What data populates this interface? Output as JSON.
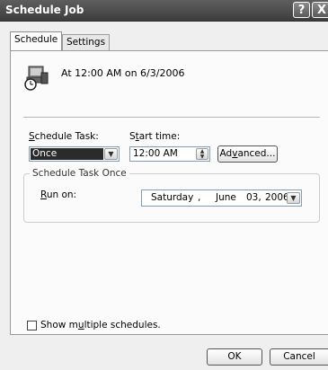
{
  "window": {
    "title": "Schedule Job",
    "help_glyph": "?",
    "close_glyph": "X"
  },
  "tabs": [
    {
      "label": "Schedule",
      "active": true
    },
    {
      "label": "Settings",
      "active": false
    }
  ],
  "summary": {
    "icon": "scheduled-task-icon",
    "text": "At 12:00 AM on 6/3/2006"
  },
  "schedule_task": {
    "label_prefix": "",
    "label_access": "S",
    "label_rest": "chedule Task:",
    "value": "Once"
  },
  "start_time": {
    "label_prefix": "S",
    "label_access": "t",
    "label_rest": "art time:",
    "value": "12:00 AM"
  },
  "advanced_button": {
    "label_prefix": "Ad",
    "label_access": "v",
    "label_rest": "anced..."
  },
  "group": {
    "title": "Schedule Task Once",
    "run_on_prefix": "",
    "run_on_access": "R",
    "run_on_rest": "un on:",
    "date": {
      "weekday": "Saturday",
      "sep1": ",",
      "month": "June",
      "day": "03,",
      "year": "2006"
    }
  },
  "show_multiple": {
    "label_prefix": "Show m",
    "label_access": "u",
    "label_rest": "ltiple schedules.",
    "checked": false
  },
  "buttons": {
    "ok": "OK",
    "cancel": "Cancel"
  },
  "colors": {
    "titlebar": "#4a4a4a",
    "selection": "#2b2b2b",
    "panel": "#fbfbfb"
  }
}
